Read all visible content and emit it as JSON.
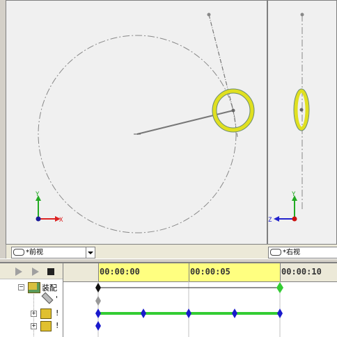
{
  "viewports": {
    "front": {
      "label": "*前视",
      "axes": {
        "x": "X",
        "y": "Y"
      }
    },
    "right": {
      "label": "*右视",
      "axes": {
        "z": "Z",
        "y": "Y"
      }
    }
  },
  "timeline": {
    "time_labels": [
      "00:00:00",
      "00:00:05",
      "00:00:10"
    ],
    "tree": [
      {
        "text": "装配",
        "expander": "−"
      },
      {
        "text": "'",
        "expander": ""
      },
      {
        "text": "!",
        "expander": "+"
      },
      {
        "text": "!",
        "expander": "+"
      }
    ]
  },
  "icons": [
    "play-icon",
    "play-icon",
    "stop-icon",
    "link-icon",
    "chevron-down-icon",
    "assembly-icon",
    "part-icon",
    "wrench-icon",
    "diamond-keyframe-icon"
  ],
  "colors": {
    "keyframe": "#1a1acc",
    "track_green": "#33cc33",
    "ring": "#e0e020",
    "x_axis": "#dd2222",
    "y_axis": "#22aa22",
    "z_axis": "#2222cc",
    "timeline_highlight": "#ffff80"
  }
}
